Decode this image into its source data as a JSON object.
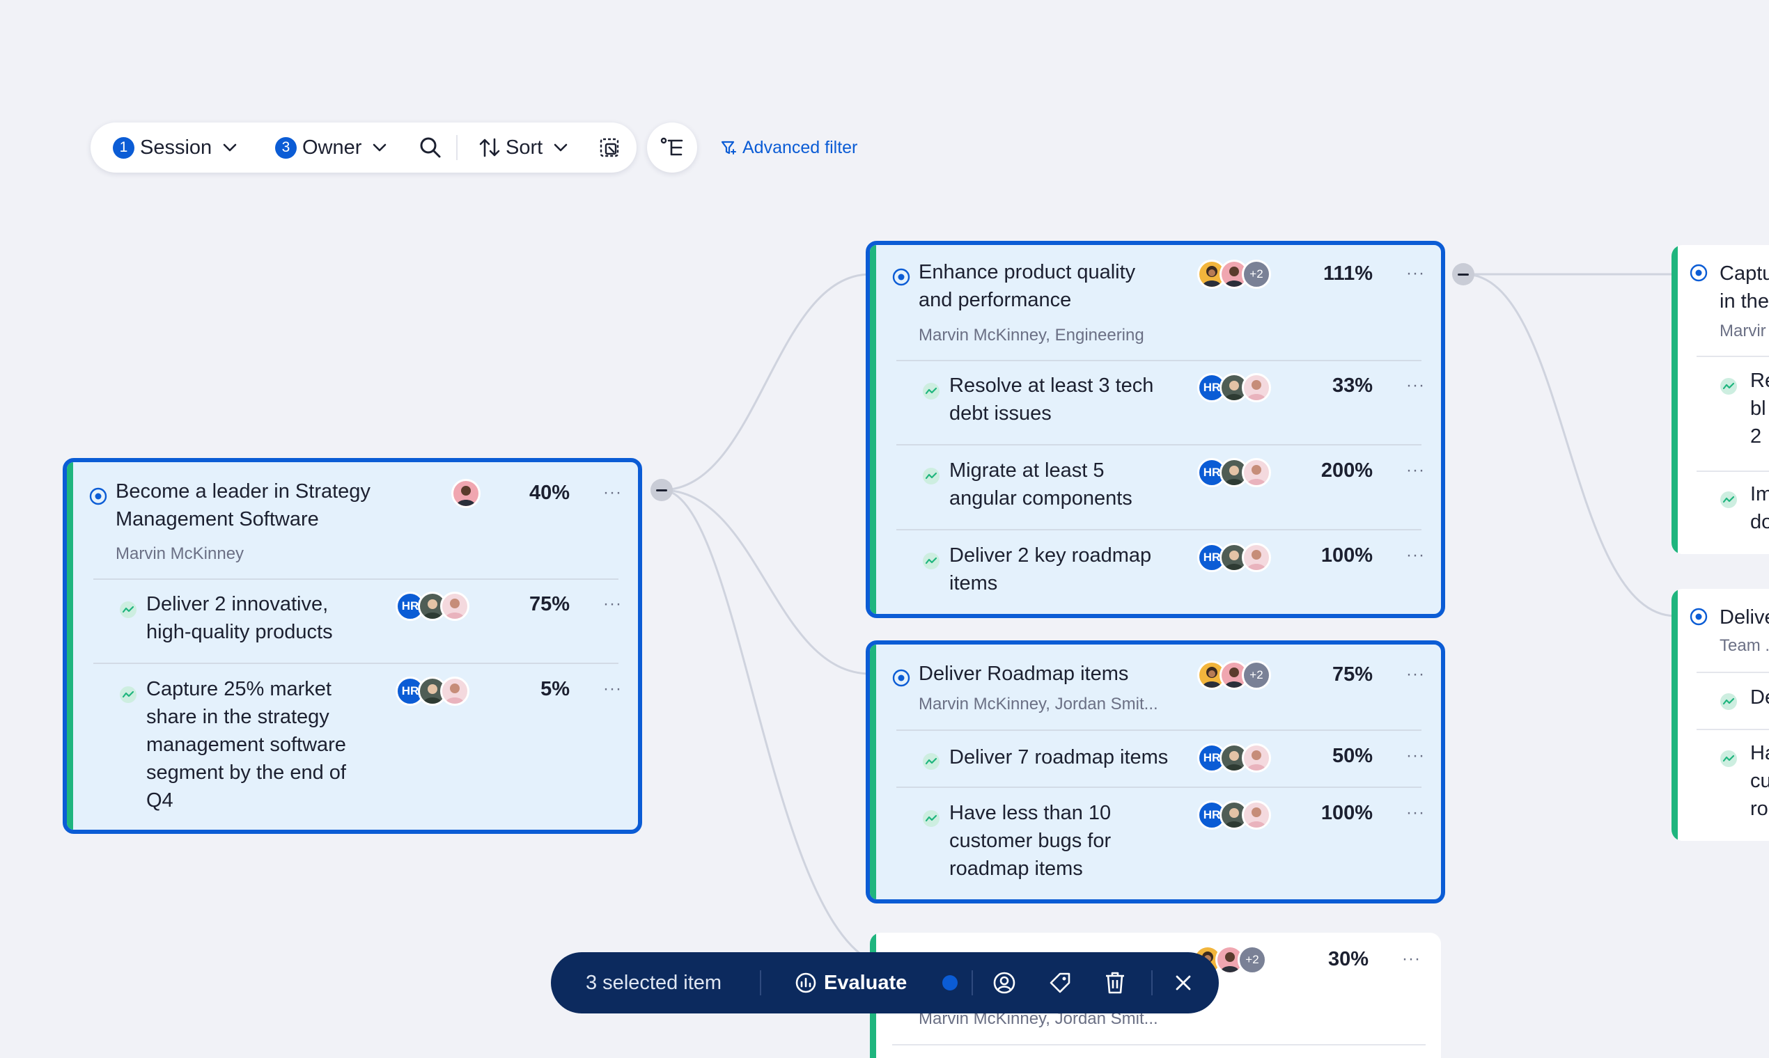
{
  "toolbar": {
    "session": {
      "count": "1",
      "label": "Session"
    },
    "owner": {
      "count": "3",
      "label": "Owner"
    },
    "sort_label": "Sort",
    "advanced_filter_label": "Advanced filter"
  },
  "cards": {
    "leader": {
      "title_line1": "Become a leader in Strategy",
      "title_line2": "Management Software",
      "owner": "Marvin McKinney",
      "pct": "40%",
      "krs": [
        {
          "line1": "Deliver 2 innovative,",
          "line2": "high-quality products",
          "pct": "75%",
          "avatar_label": "HR"
        },
        {
          "line1": "Capture 25% market",
          "line2": "share in the strategy",
          "line3": "management software",
          "line4": "segment by the end of",
          "line5": "Q4",
          "pct": "5%",
          "avatar_label": "HR"
        }
      ]
    },
    "quality": {
      "title_line1": "Enhance product quality",
      "title_line2": "and performance",
      "owner": "Marvin McKinney, Engineering",
      "pct": "111%",
      "more_count": "+2",
      "krs": [
        {
          "line1": "Resolve at least 3 tech",
          "line2": "debt issues",
          "pct": "33%",
          "avatar_label": "HR"
        },
        {
          "line1": "Migrate at least 5",
          "line2": "angular components",
          "pct": "200%",
          "avatar_label": "HR"
        },
        {
          "line1": "Deliver 2 key roadmap",
          "line2": "items",
          "pct": "100%",
          "avatar_label": "HR"
        }
      ]
    },
    "roadmap": {
      "title": "Deliver Roadmap items",
      "owner": "Marvin McKinney, Jordan Smit...",
      "pct": "75%",
      "more_count": "+2",
      "krs": [
        {
          "line1": "Deliver 7 roadmap items",
          "pct": "50%",
          "avatar_label": "HR"
        },
        {
          "line1": "Have less than  10",
          "line2": "customer bugs for",
          "line3": "roadmap items",
          "pct": "100%",
          "avatar_label": "HR"
        }
      ]
    },
    "bottom": {
      "owner": "Marvin McKinney, Jordan Smit...",
      "pct": "30%",
      "more_count": "+2"
    },
    "right_top": {
      "title_line1": "Captu",
      "title_line2": "in the",
      "owner": "Marvir",
      "krs": [
        {
          "line1": "Re",
          "line2": "bl",
          "line3": "2"
        },
        {
          "line1": "Im",
          "line2": "do"
        }
      ]
    },
    "right_bottom": {
      "title": "Delive",
      "owner": "Team .",
      "krs": [
        {
          "line1": "De"
        },
        {
          "line1": "Ha",
          "line2": "cu",
          "line3": "ro"
        }
      ]
    }
  },
  "more_glyph": "···",
  "selection_bar": {
    "count_text": "3 selected item",
    "evaluate_label": "Evaluate"
  },
  "colors": {
    "primary": "#0b5cd5",
    "accent_green": "#1fb57e",
    "card_selected_bg": "#e4f1fc",
    "selection_bar_bg": "#0c2a5e"
  }
}
